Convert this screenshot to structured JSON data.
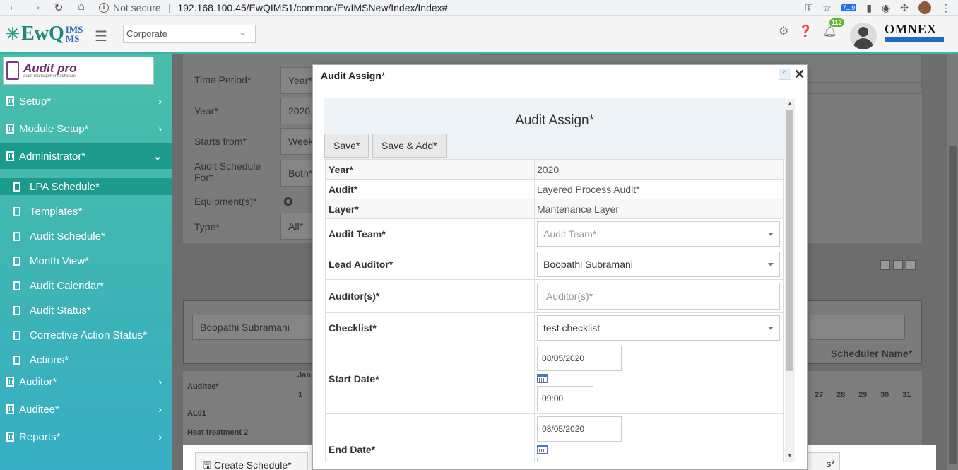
{
  "browser": {
    "security": "Not secure",
    "url": "192.168.100.45/EwQIMS1/common/EwIMSNew/Index/Index#",
    "ext_badge": "71.9"
  },
  "header": {
    "logo_main": "Ew",
    "logo_q": "Q",
    "logo_top": "IMS",
    "logo_bottom": "MS",
    "corporate_value": "Corporate",
    "notifications_count": "112",
    "brand_right": "OMNEX"
  },
  "sidebar": {
    "brand_name": "Audit pro",
    "brand_sub": "audit management software",
    "items": [
      {
        "label": "Setup*"
      },
      {
        "label": "Module Setup*"
      },
      {
        "label": "Administrator*"
      },
      {
        "label": "Auditor*"
      },
      {
        "label": "Auditee*"
      },
      {
        "label": "Reports*"
      }
    ],
    "sub_items": [
      {
        "label": "LPA Schedule*"
      },
      {
        "label": "Templates*"
      },
      {
        "label": "Audit Schedule*"
      },
      {
        "label": "Month View*"
      },
      {
        "label": "Audit Calendar*"
      },
      {
        "label": "Audit Status*"
      },
      {
        "label": "Corrective Action Status*"
      },
      {
        "label": "Actions*"
      }
    ]
  },
  "background": {
    "rows": [
      {
        "label": "Time Period*",
        "value": "Year*"
      },
      {
        "label": "Year*",
        "value": "2020"
      },
      {
        "label": "Starts from*",
        "value": "Week*"
      },
      {
        "label": "Audit Schedule For*",
        "value": "Both*"
      },
      {
        "label": "Equipment(s)*",
        "value": ""
      },
      {
        "label": "Type*",
        "value": "All*"
      }
    ],
    "scheduler_name_value": "Boopathi Subramani",
    "scheduler_name_label": "Scheduler Name*",
    "grid_auditee_header": "Auditee*",
    "grid_month": "Jan",
    "grid_day_first": "1",
    "grid_days_right": [
      "27",
      "28",
      "29",
      "30",
      "31"
    ],
    "grid_rows": [
      "AL01",
      "Heat treatment 2"
    ],
    "create_schedule": "Create Schedule*",
    "right_button_tail": "s*"
  },
  "modal": {
    "title": "Audit Assign",
    "title_star": "*",
    "panel_title": "Audit Assign*",
    "save": "Save*",
    "save_add": "Save & Add*",
    "fields": {
      "year_label": "Year*",
      "year_value": "2020",
      "audit_label": "Audit*",
      "audit_value": "Layered Process Audit*",
      "layer_label": "Layer*",
      "layer_value": "Mantenance Layer",
      "team_label": "Audit Team*",
      "team_placeholder": "Audit Team*",
      "lead_label": "Lead Auditor*",
      "lead_value": "Boopathi Subramani",
      "auditors_label": "Auditor(s)*",
      "auditors_placeholder": "Auditor(s)*",
      "checklist_label": "Checklist*",
      "checklist_value": "test checklist",
      "start_label": "Start Date*",
      "start_date": "08/05/2020",
      "start_time": "09:00",
      "end_label": "End Date*",
      "end_date": "08/05/2020"
    }
  }
}
